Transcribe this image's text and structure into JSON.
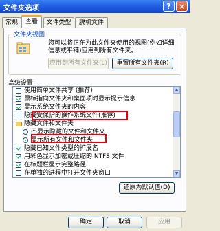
{
  "window": {
    "title": "文件夹选项",
    "help_label": "?",
    "close_label": "×"
  },
  "tabs": [
    {
      "label": "常规",
      "active": false
    },
    {
      "label": "查看",
      "active": true
    },
    {
      "label": "文件类型",
      "active": false
    },
    {
      "label": "脱机文件",
      "active": false
    }
  ],
  "folder_views": {
    "legend": "文件夹视图",
    "description": "您可以将正在为此文件夹使用的视图(例如详细信息或平铺)应用到所有文件夹。",
    "apply_all_label": "应用到所有文件夹(L)",
    "reset_all_label": "重置所有文件夹(R)"
  },
  "advanced": {
    "label": "高级设置:",
    "items": [
      {
        "type": "checkbox",
        "checked": false,
        "label": "使用简单文件共享 (推荐)"
      },
      {
        "type": "checkbox",
        "checked": true,
        "label": "鼠标指向文件夹和桌面项时显示提示信息"
      },
      {
        "type": "checkbox",
        "checked": true,
        "label": "显示系统文件夹的内容"
      },
      {
        "type": "checkbox",
        "checked": false,
        "label": "隐藏受保护的操作系统文件(推荐)"
      },
      {
        "type": "folder",
        "label": "隐藏文件和文件夹"
      },
      {
        "type": "radio",
        "checked": false,
        "label": "不显示隐藏的文件和文件夹"
      },
      {
        "type": "radio",
        "checked": true,
        "label": "显示所有文件和文件夹"
      },
      {
        "type": "checkbox",
        "checked": true,
        "label": "隐藏已知文件类型的扩展名"
      },
      {
        "type": "checkbox",
        "checked": true,
        "label": "用彩色显示加密或压缩的 NTFS 文件"
      },
      {
        "type": "checkbox",
        "checked": true,
        "label": "在标题栏显示完整路径"
      },
      {
        "type": "checkbox",
        "checked": false,
        "label": "在单独的进程中打开文件夹窗口"
      }
    ],
    "restore_label": "还原为默认值(D)"
  },
  "footer": {
    "ok_label": "确定",
    "cancel_label": "取消",
    "apply_label": "应用"
  },
  "colors": {
    "titlebar": "#1c5ae0",
    "highlight_box": "#e60012",
    "legend_text": "#0046d5"
  }
}
